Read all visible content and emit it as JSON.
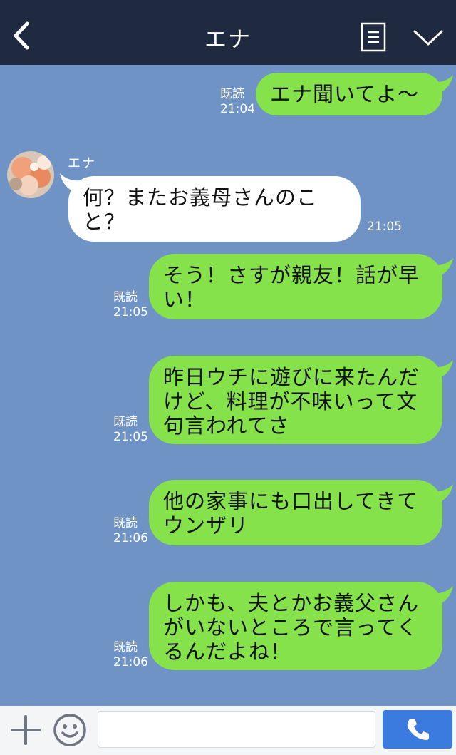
{
  "header": {
    "title": "エナ"
  },
  "chat": {
    "sender_name": "エナ",
    "messages": [
      {
        "dir": "out",
        "text": "エナ聞いてよ〜",
        "read": "既読",
        "time": "21:04"
      },
      {
        "dir": "in",
        "text": "何？またお義母さんのこと？",
        "time": "21:05"
      },
      {
        "dir": "out",
        "text": "そう！さすが親友！話が早い！",
        "read": "既読",
        "time": "21:05"
      },
      {
        "dir": "out",
        "text": "昨日ウチに遊びに来たんだけど、料理が不味いって文句言われてさ",
        "read": "既読",
        "time": "21:05"
      },
      {
        "dir": "out",
        "text": "他の家事にも口出してきてウンザリ",
        "read": "既読",
        "time": "21:06"
      },
      {
        "dir": "out",
        "text": "しかも、夫とかお義父さんがいないところで言ってくるんだよね！",
        "read": "既読",
        "time": "21:06"
      }
    ]
  },
  "footer": {
    "input_value": ""
  },
  "colors": {
    "header_bg": "#1f2a40",
    "chat_bg": "#7093c5",
    "outgoing_bubble": "#86e24a",
    "incoming_bubble": "#ffffff",
    "call_button": "#3b7be0"
  },
  "icons": [
    "back-chevron-icon",
    "notes-icon",
    "chevron-down-icon",
    "plus-icon",
    "emoji-icon",
    "phone-icon"
  ]
}
